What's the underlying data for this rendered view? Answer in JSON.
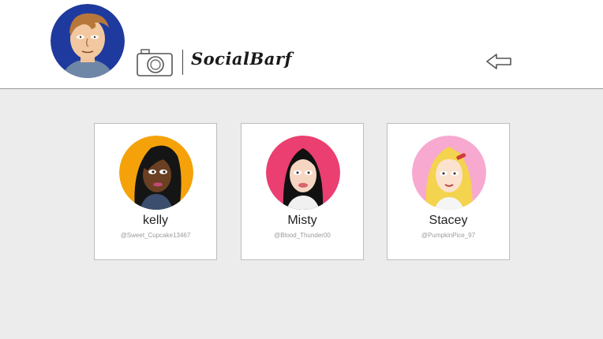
{
  "app": {
    "brand": "SocialBarf",
    "icons": {
      "profile": "user-avatar",
      "camera": "camera-icon",
      "back": "back-arrow-icon"
    }
  },
  "profiles": [
    {
      "name": "kelly",
      "handle": "@Sweet_Cupcake13467",
      "avatar_bg": "#f5a20a"
    },
    {
      "name": "Misty",
      "handle": "@Blood_Thunder00",
      "avatar_bg": "#ea3f70"
    },
    {
      "name": "Stacey",
      "handle": "@PumpkinPice_97",
      "avatar_bg": "#f7a9cf"
    }
  ]
}
